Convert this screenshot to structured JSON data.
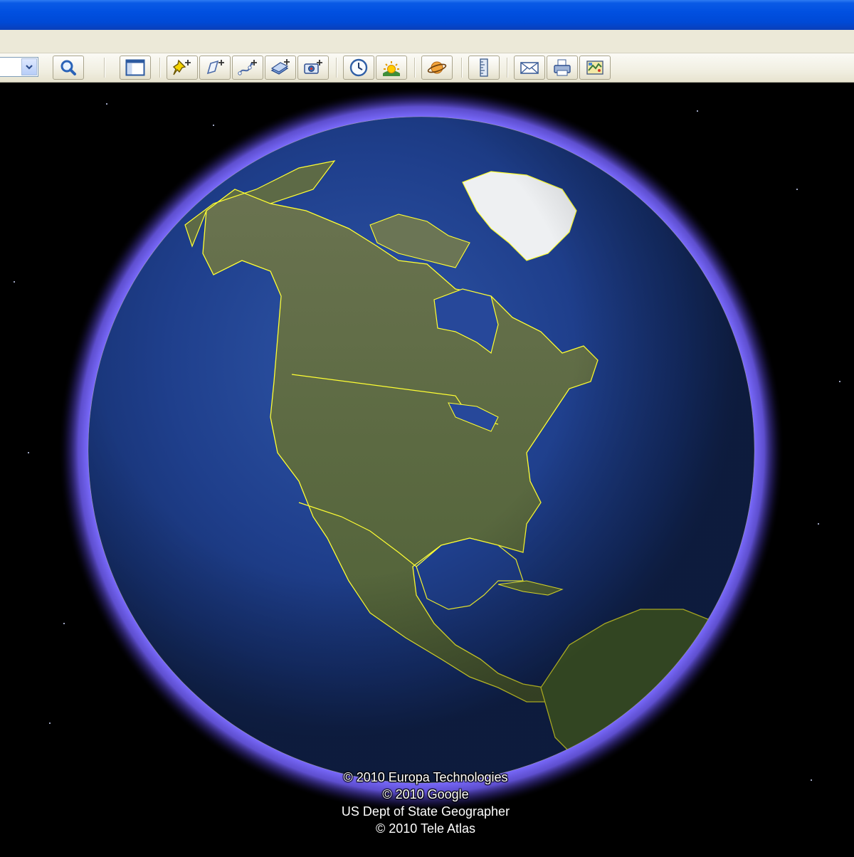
{
  "colors": {
    "titlebar": "#0150e0",
    "toolbar_bg": "#f1efe2",
    "space": "#000000",
    "atmosphere": "#7b6cff",
    "ocean": "#1f3f8c",
    "land": "#5e6b44",
    "ice": "#eef0f2",
    "borders": "#ffff33"
  },
  "toolbar": {
    "buttons": [
      {
        "name": "search-button",
        "icon": "magnifier-icon"
      },
      {
        "name": "sidebar-toggle-button",
        "icon": "sidebar-icon"
      },
      {
        "name": "add-placemark-button",
        "icon": "pushpin-add-icon"
      },
      {
        "name": "add-polygon-button",
        "icon": "polygon-add-icon"
      },
      {
        "name": "add-path-button",
        "icon": "path-add-icon"
      },
      {
        "name": "add-image-overlay-button",
        "icon": "overlay-add-icon"
      },
      {
        "name": "record-tour-button",
        "icon": "camera-add-icon"
      },
      {
        "name": "historical-imagery-button",
        "icon": "clock-icon"
      },
      {
        "name": "sunlight-button",
        "icon": "sun-icon"
      },
      {
        "name": "switch-planet-button",
        "icon": "planet-icon"
      },
      {
        "name": "ruler-button",
        "icon": "ruler-icon"
      },
      {
        "name": "email-button",
        "icon": "envelope-icon"
      },
      {
        "name": "print-button",
        "icon": "printer-icon"
      },
      {
        "name": "view-in-maps-button",
        "icon": "map-icon"
      }
    ]
  },
  "globe": {
    "view": "North America"
  },
  "attribution": {
    "lines": [
      "© 2010 Europa Technologies",
      "© 2010 Google",
      "US Dept of State Geographer",
      "© 2010 Tele Atlas"
    ]
  }
}
